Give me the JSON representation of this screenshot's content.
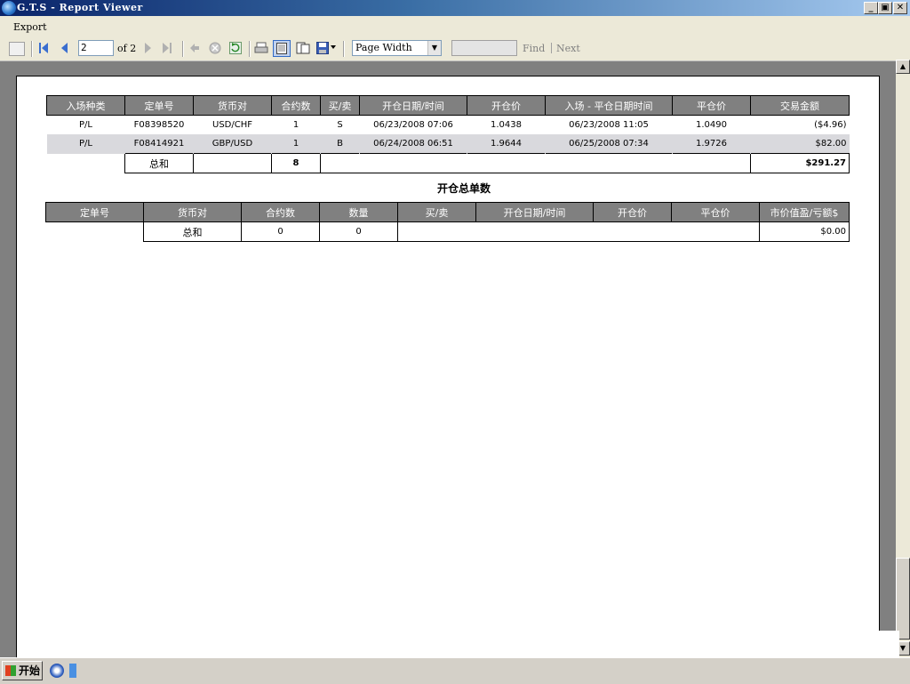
{
  "window": {
    "title": "G.T.S - Report Viewer"
  },
  "menu": {
    "export": "Export"
  },
  "toolbar": {
    "page_current": "2",
    "page_total_text": "of 2",
    "zoom": "Page Width",
    "find_placeholder": "",
    "find": "Find",
    "next": "Next"
  },
  "table1": {
    "headers": [
      "入场种类",
      "定单号",
      "货币对",
      "合约数",
      "买/卖",
      "开仓日期/时间",
      "开仓价",
      "入场 - 平仓日期时间",
      "平仓价",
      "交易金额"
    ],
    "rows": [
      [
        "P/L",
        "F08398520",
        "USD/CHF",
        "1",
        "S",
        "06/23/2008 07:06",
        "1.0438",
        "06/23/2008 11:05",
        "1.0490",
        "($4.96)"
      ],
      [
        "P/L",
        "F08414921",
        "GBP/USD",
        "1",
        "B",
        "06/24/2008 06:51",
        "1.9644",
        "06/25/2008 07:34",
        "1.9726",
        "$82.00"
      ]
    ],
    "total_label": "总和",
    "total_contracts": "8",
    "total_amount": "$291.27"
  },
  "section_title": "开仓总单数",
  "table2": {
    "headers": [
      "定单号",
      "货币对",
      "合约数",
      "数量",
      "买/卖",
      "开仓日期/时间",
      "开仓价",
      "平仓价",
      "市价值盈/亏额$"
    ],
    "total_label": "总和",
    "total_contracts": "0",
    "total_quantity": "0",
    "total_value": "$0.00"
  },
  "taskbar": {
    "start": "开始"
  }
}
